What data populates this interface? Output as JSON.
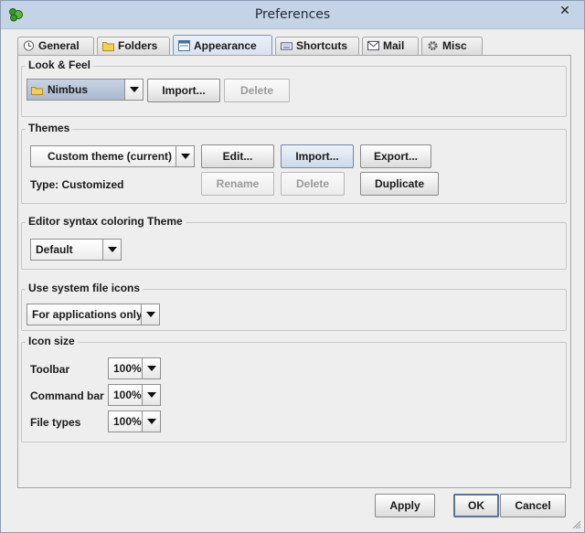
{
  "window": {
    "title": "Preferences",
    "close_glyph": "✕"
  },
  "tabs": [
    {
      "label": "General",
      "icon": "clock-icon"
    },
    {
      "label": "Folders",
      "icon": "folder-icon"
    },
    {
      "label": "Appearance",
      "icon": "window-icon",
      "active": true
    },
    {
      "label": "Shortcuts",
      "icon": "keyboard-icon"
    },
    {
      "label": "Mail",
      "icon": "envelope-icon"
    },
    {
      "label": "Misc",
      "icon": "gear-icon"
    }
  ],
  "look_feel": {
    "title": "Look & Feel",
    "selected": "Nimbus",
    "import_label": "Import...",
    "delete_label": "Delete"
  },
  "themes": {
    "title": "Themes",
    "selected": "Custom theme (current)",
    "edit_label": "Edit...",
    "import_label": "Import...",
    "export_label": "Export...",
    "type_text": "Type: Customized",
    "rename_label": "Rename",
    "delete_label": "Delete",
    "duplicate_label": "Duplicate"
  },
  "syntax": {
    "title": "Editor syntax coloring Theme",
    "selected": "Default"
  },
  "file_icons": {
    "title": "Use system file icons",
    "selected": "For applications only"
  },
  "icon_size": {
    "title": "Icon size",
    "rows": [
      {
        "label": "Toolbar",
        "value": "100%"
      },
      {
        "label": "Command bar",
        "value": "100%"
      },
      {
        "label": "File types",
        "value": "100%"
      }
    ]
  },
  "footer": {
    "apply": "Apply",
    "ok": "OK",
    "cancel": "Cancel"
  }
}
